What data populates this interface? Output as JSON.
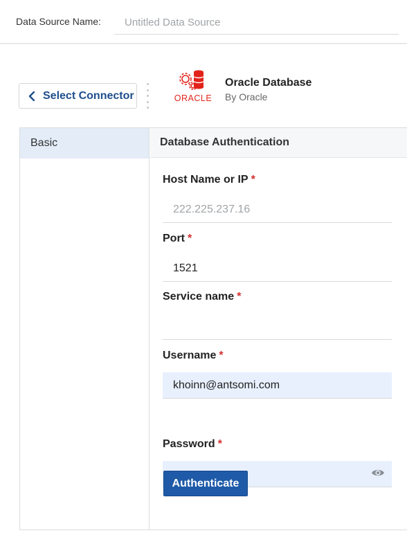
{
  "header": {
    "data_source_label": "Data Source Name:",
    "data_source_placeholder": "Untitled Data Source",
    "data_source_value": ""
  },
  "connector": {
    "back_label": "Select Connector",
    "name": "Oracle Database",
    "by": "By Oracle",
    "logo_text": "ORACLE",
    "brand_color": "#e2231a"
  },
  "sidebar": {
    "items": [
      {
        "label": "Basic",
        "active": true
      }
    ]
  },
  "form": {
    "section_title": "Database Authentication",
    "fields": [
      {
        "label": "Host Name or IP",
        "required": "*",
        "placeholder": "222.225.237.16",
        "value": ""
      },
      {
        "label": "Port",
        "required": "*",
        "placeholder": "",
        "value": "1521"
      },
      {
        "label": "Service name",
        "required": "*",
        "placeholder": "",
        "value": ""
      },
      {
        "label": "Username",
        "required": "*",
        "placeholder": "",
        "value": "khoinn@antsomi.com"
      },
      {
        "label": "Password",
        "required": "*",
        "placeholder": "",
        "value": "•••••••••••••"
      }
    ],
    "authenticate_label": "Authenticate"
  }
}
